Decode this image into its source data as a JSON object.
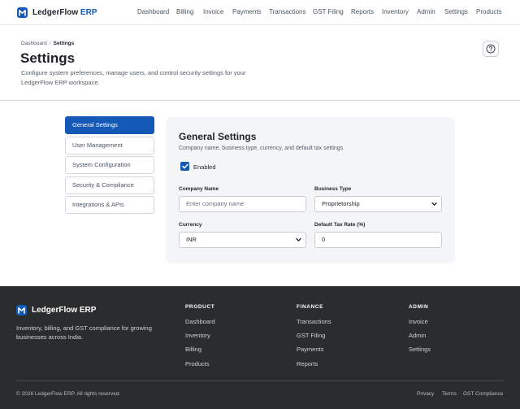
{
  "brand": {
    "name": "LedgerFlow",
    "accent": "ERP",
    "logo_icon": "ledger-m-logo"
  },
  "nav": {
    "items": [
      {
        "label": "Dashboard"
      },
      {
        "label": "Billing"
      },
      {
        "label": "Invoice"
      },
      {
        "label": "Payments"
      },
      {
        "label": "Transactions"
      },
      {
        "label": "GST Filing"
      },
      {
        "label": "Reports"
      },
      {
        "label": "Inventory"
      },
      {
        "label": "Admin"
      },
      {
        "label": "Settings"
      },
      {
        "label": "Products"
      }
    ]
  },
  "header": {
    "breadcrumb": {
      "root": "Dashboard",
      "separator": "/",
      "current": "Settings"
    },
    "title": "Settings",
    "description": "Configure system preferences, manage users, and control security settings for your LedgerFlow ERP workspace.",
    "help_icon": "question-circle-icon"
  },
  "sidebar": {
    "items": [
      {
        "label": "General Settings",
        "active": true
      },
      {
        "label": "User Management",
        "active": false
      },
      {
        "label": "System Configuration",
        "active": false
      },
      {
        "label": "Security & Compliance",
        "active": false
      },
      {
        "label": "Integrations & APIs",
        "active": false
      }
    ]
  },
  "panel": {
    "title": "General Settings",
    "subtitle": "Company name, business type, currency, and default tax settings",
    "enabled": {
      "label": "Enabled",
      "checked": true
    },
    "company_name": {
      "label": "Company Name",
      "value": "",
      "placeholder": "Enter company name"
    },
    "business_type": {
      "label": "Business Type",
      "value": "Proprietorship"
    },
    "currency": {
      "label": "Currency",
      "value": "INR"
    },
    "tax_rate": {
      "label": "Default Tax Rate (%)",
      "value": "0"
    }
  },
  "footer": {
    "brand": "LedgerFlow ERP",
    "description": "Inventory, billing, and GST compliance for growing businesses across India.",
    "columns": [
      {
        "heading": "PRODUCT",
        "links": [
          "Dashboard",
          "Inventory",
          "Billing",
          "Products"
        ]
      },
      {
        "heading": "FINANCE",
        "links": [
          "Transactions",
          "GST Filing",
          "Payments",
          "Reports"
        ]
      },
      {
        "heading": "ADMIN",
        "links": [
          "Invoice",
          "Admin",
          "Settings"
        ]
      }
    ],
    "copyright": "© 2026 LedgerFlow ERP. All rights reserved.",
    "legal": [
      "Privacy",
      "Terms",
      "GST Compliance"
    ]
  },
  "colors": {
    "primary": "#1559b6",
    "footer_bg": "#2b2c2e",
    "card_bg": "#f4f5f7",
    "text": "#1f2328",
    "muted": "#555b65"
  }
}
